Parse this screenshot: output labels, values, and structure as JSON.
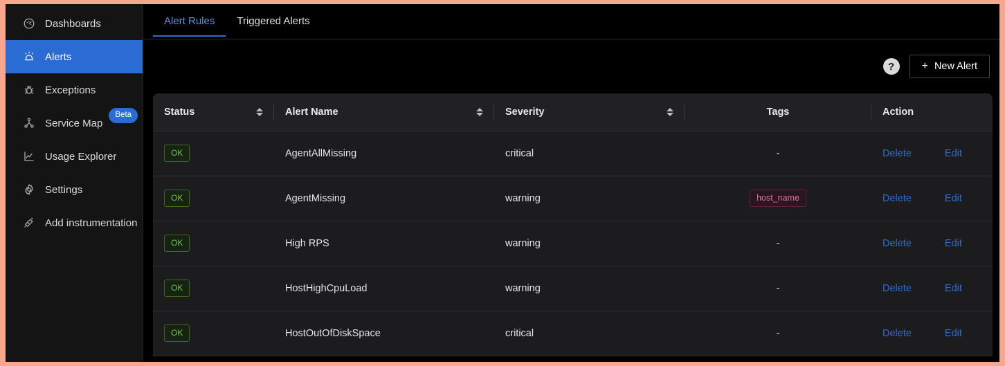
{
  "sidebar": {
    "items": [
      {
        "label": "Dashboards",
        "icon": "gauge-icon",
        "active": false,
        "badge": null
      },
      {
        "label": "Alerts",
        "icon": "alarm-icon",
        "active": true,
        "badge": null
      },
      {
        "label": "Exceptions",
        "icon": "bug-icon",
        "active": false,
        "badge": null
      },
      {
        "label": "Service Map",
        "icon": "sitemap-icon",
        "active": false,
        "badge": "Beta"
      },
      {
        "label": "Usage Explorer",
        "icon": "line-chart-icon",
        "active": false,
        "badge": null
      },
      {
        "label": "Settings",
        "icon": "gear-icon",
        "active": false,
        "badge": null
      },
      {
        "label": "Add instrumentation",
        "icon": "api-link-icon",
        "active": false,
        "badge": null
      }
    ]
  },
  "tabs": [
    {
      "label": "Alert Rules",
      "active": true
    },
    {
      "label": "Triggered Alerts",
      "active": false
    }
  ],
  "toolbar": {
    "help_label": "?",
    "new_alert_label": "New Alert",
    "plus_glyph": "+"
  },
  "table": {
    "columns": [
      {
        "label": "Status",
        "sortable": true,
        "align": "left"
      },
      {
        "label": "Alert Name",
        "sortable": true,
        "align": "left"
      },
      {
        "label": "Severity",
        "sortable": true,
        "align": "left"
      },
      {
        "label": "Tags",
        "sortable": false,
        "align": "center"
      },
      {
        "label": "Action",
        "sortable": false,
        "align": "left"
      }
    ],
    "action_labels": {
      "delete": "Delete",
      "edit": "Edit"
    },
    "empty_tag": "-",
    "rows": [
      {
        "status": "OK",
        "name": "AgentAllMissing",
        "severity": "critical",
        "tags": []
      },
      {
        "status": "OK",
        "name": "AgentMissing",
        "severity": "warning",
        "tags": [
          "host_name"
        ]
      },
      {
        "status": "OK",
        "name": "High RPS",
        "severity": "warning",
        "tags": []
      },
      {
        "status": "OK",
        "name": "HostHighCpuLoad",
        "severity": "warning",
        "tags": []
      },
      {
        "status": "OK",
        "name": "HostOutOfDiskSpace",
        "severity": "critical",
        "tags": []
      }
    ]
  },
  "colors": {
    "accent_blue": "#2b6cd4",
    "status_green": "#76c24a",
    "tag_pink": "#e06fa0",
    "page_bg": "#000000",
    "sidebar_bg": "#141414",
    "table_bg": "#1c1c1e",
    "frame_border": "#f8a78f"
  }
}
